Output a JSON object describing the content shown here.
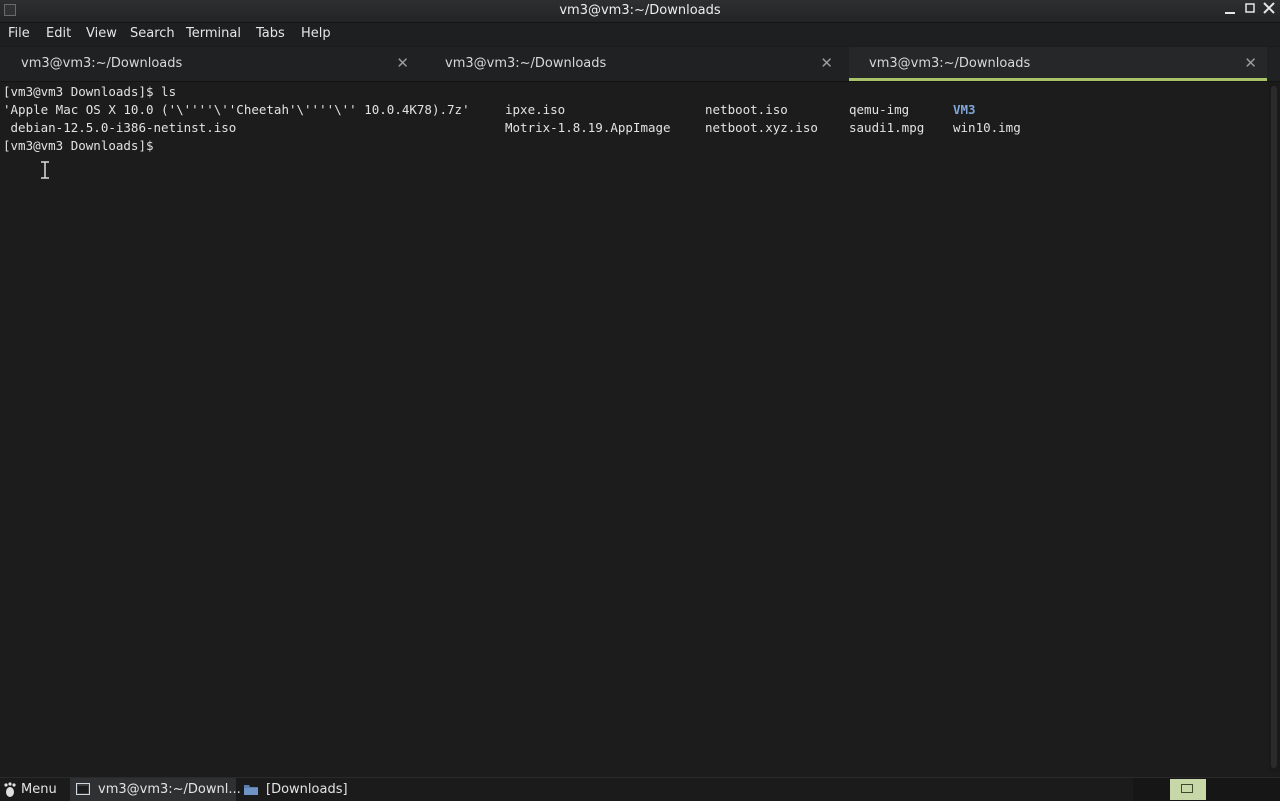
{
  "window": {
    "title": "vm3@vm3:~/Downloads"
  },
  "menu": [
    "File",
    "Edit",
    "View",
    "Search",
    "Terminal",
    "Tabs",
    "Help"
  ],
  "tabs": [
    {
      "label": "vm3@vm3:~/Downloads",
      "active": false
    },
    {
      "label": "vm3@vm3:~/Downloads",
      "active": false
    },
    {
      "label": "vm3@vm3:~/Downloads",
      "active": true
    }
  ],
  "terminal": {
    "prompt_command": "[vm3@vm3 Downloads]$ ls",
    "ls_rows": [
      [
        "'Apple Mac OS X 10.0 ('\\''''\\''Cheetah'\\''''\\'' 10.0.4K78).7z'",
        "ipxe.iso",
        "netboot.iso",
        "qemu-img",
        "VM3"
      ],
      [
        " debian-12.5.0-i386-netinst.iso",
        "Motrix-1.8.19.AppImage",
        "netboot.xyz.iso",
        "saudi1.mpg",
        "win10.img"
      ]
    ],
    "prompt_current": "[vm3@vm3 Downloads]$",
    "directory_entries": [
      "VM3"
    ]
  },
  "taskbar": {
    "menu_label": "Menu",
    "items": [
      {
        "label": "vm3@vm3:~/Downl...",
        "icon": "terminal-icon",
        "active": true
      },
      {
        "label": "[Downloads]",
        "icon": "folder-icon",
        "active": false
      }
    ]
  },
  "colors": {
    "tab_accent": "#a7c46a",
    "directory": "#7ea6d9",
    "background": "#1c1c1c"
  }
}
